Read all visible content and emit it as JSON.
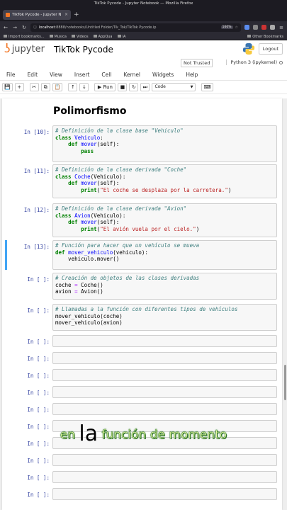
{
  "window": {
    "title": "TikTok Pycode - Jupyter Notebook — Mozilla Firefox"
  },
  "browser": {
    "tab_title": "TikTok Pycode - Jupyter N",
    "tab_close": "×",
    "new_tab": "+",
    "url_host": "localhost",
    "url_rest": ":8888/notebooks/Untitled Folder/Tik_Tok/TikTok Pycode.ip",
    "zoom": "160%",
    "bookmarks": [
      "Import bookmarks...",
      "Musica",
      "Videos",
      "AppQua",
      "IA"
    ],
    "other_bookmarks": "Other Bookmarks"
  },
  "jupyter": {
    "logo_text": "jupyter",
    "notebook_title": "TikTok Pycode",
    "logout_label": "Logout",
    "trust_status": "Not Trusted",
    "kernel_name": "Python 3 (ipykernel)",
    "menu": [
      "File",
      "Edit",
      "View",
      "Insert",
      "Cell",
      "Kernel",
      "Widgets",
      "Help"
    ],
    "toolbar": {
      "save": "💾",
      "add": "+",
      "cut": "✂",
      "copy": "⧉",
      "paste": "📋",
      "up": "↑",
      "down": "↓",
      "run": "▶ Run",
      "stop": "■",
      "restart": "↻",
      "restart_run": "⏭",
      "cell_type": "Code",
      "keyboard": "⌨"
    }
  },
  "notebook": {
    "heading": "Polimorfismo",
    "cells": [
      {
        "prompt": "In [10]:",
        "lines": [
          [
            [
              "c-comment",
              "# Definición de la clase base \"Vehiculo\""
            ]
          ],
          [
            [
              "c-kw",
              "class "
            ],
            [
              "c-def",
              "Vehiculo"
            ],
            [
              "c-plain",
              ":"
            ]
          ],
          [
            [
              "c-plain",
              "    "
            ],
            [
              "c-kw",
              "def "
            ],
            [
              "c-def",
              "mover"
            ],
            [
              "c-plain",
              "(self):"
            ]
          ],
          [
            [
              "c-plain",
              "        "
            ],
            [
              "c-kw",
              "pass"
            ]
          ]
        ]
      },
      {
        "prompt": "In [11]:",
        "lines": [
          [
            [
              "c-comment",
              "# Definición de la clase derivada \"Coche\""
            ]
          ],
          [
            [
              "c-kw",
              "class "
            ],
            [
              "c-def",
              "Coche"
            ],
            [
              "c-plain",
              "(Vehiculo):"
            ]
          ],
          [
            [
              "c-plain",
              "    "
            ],
            [
              "c-kw",
              "def "
            ],
            [
              "c-def",
              "mover"
            ],
            [
              "c-plain",
              "(self):"
            ]
          ],
          [
            [
              "c-plain",
              "        "
            ],
            [
              "c-kw",
              "print"
            ],
            [
              "c-plain",
              "("
            ],
            [
              "c-str",
              "\"El coche se desplaza por la carretera.\""
            ],
            [
              "c-plain",
              ")"
            ]
          ]
        ]
      },
      {
        "prompt": "In [12]:",
        "lines": [
          [
            [
              "c-comment",
              "# Definición de la clase derivada \"Avion\""
            ]
          ],
          [
            [
              "c-kw",
              "class "
            ],
            [
              "c-def",
              "Avion"
            ],
            [
              "c-plain",
              "(Vehiculo):"
            ]
          ],
          [
            [
              "c-plain",
              "    "
            ],
            [
              "c-kw",
              "def "
            ],
            [
              "c-def",
              "mover"
            ],
            [
              "c-plain",
              "(self):"
            ]
          ],
          [
            [
              "c-plain",
              "        "
            ],
            [
              "c-kw",
              "print"
            ],
            [
              "c-plain",
              "("
            ],
            [
              "c-str",
              "\"El avión vuela por el cielo.\""
            ],
            [
              "c-plain",
              ")"
            ]
          ]
        ]
      },
      {
        "prompt": "In [13]:",
        "selected": true,
        "lines": [
          [
            [
              "c-comment",
              "# Función para hacer que un vehículo se mueva"
            ]
          ],
          [
            [
              "c-kw",
              "def "
            ],
            [
              "c-def",
              "mover_vehiculo"
            ],
            [
              "c-plain",
              "(vehiculo):"
            ]
          ],
          [
            [
              "c-plain",
              "    vehiculo.mover()"
            ]
          ]
        ]
      },
      {
        "prompt": "In [ ]:",
        "lines": [
          [
            [
              "c-comment",
              "# Creación de objetos de las clases derivadas"
            ]
          ],
          [
            [
              "c-plain",
              "coche "
            ],
            [
              "c-op",
              "="
            ],
            [
              "c-plain",
              " Coche()"
            ]
          ],
          [
            [
              "c-plain",
              "avion "
            ],
            [
              "c-op",
              "="
            ],
            [
              "c-plain",
              " Avion()"
            ]
          ]
        ]
      },
      {
        "prompt": "In [ ]:",
        "lines": [
          [
            [
              "c-comment",
              "# Llamadas a la función con diferentes tipos de vehículos"
            ]
          ],
          [
            [
              "c-plain",
              "mover_vehiculo(coche)"
            ]
          ],
          [
            [
              "c-plain",
              "mover_vehiculo(avion)"
            ]
          ]
        ]
      },
      {
        "prompt": "In [ ]:",
        "lines": []
      },
      {
        "prompt": "In [ ]:",
        "lines": []
      },
      {
        "prompt": "In [ ]:",
        "lines": []
      },
      {
        "prompt": "In [ ]:",
        "lines": []
      },
      {
        "prompt": "In [ ]:",
        "lines": []
      },
      {
        "prompt": "In [ ]:",
        "lines": []
      },
      {
        "prompt": "In [ ]:",
        "lines": []
      },
      {
        "prompt": "In [ ]:",
        "lines": []
      },
      {
        "prompt": "In [ ]:",
        "lines": []
      },
      {
        "prompt": "In [ ]:",
        "lines": []
      }
    ]
  },
  "caption": {
    "before": "en ",
    "big": "la",
    "after": " función de momento"
  },
  "colors": {
    "jupyter_orange": "#f37726",
    "selected_cell": "#42a5f5",
    "prompt_blue": "#303f9f"
  }
}
